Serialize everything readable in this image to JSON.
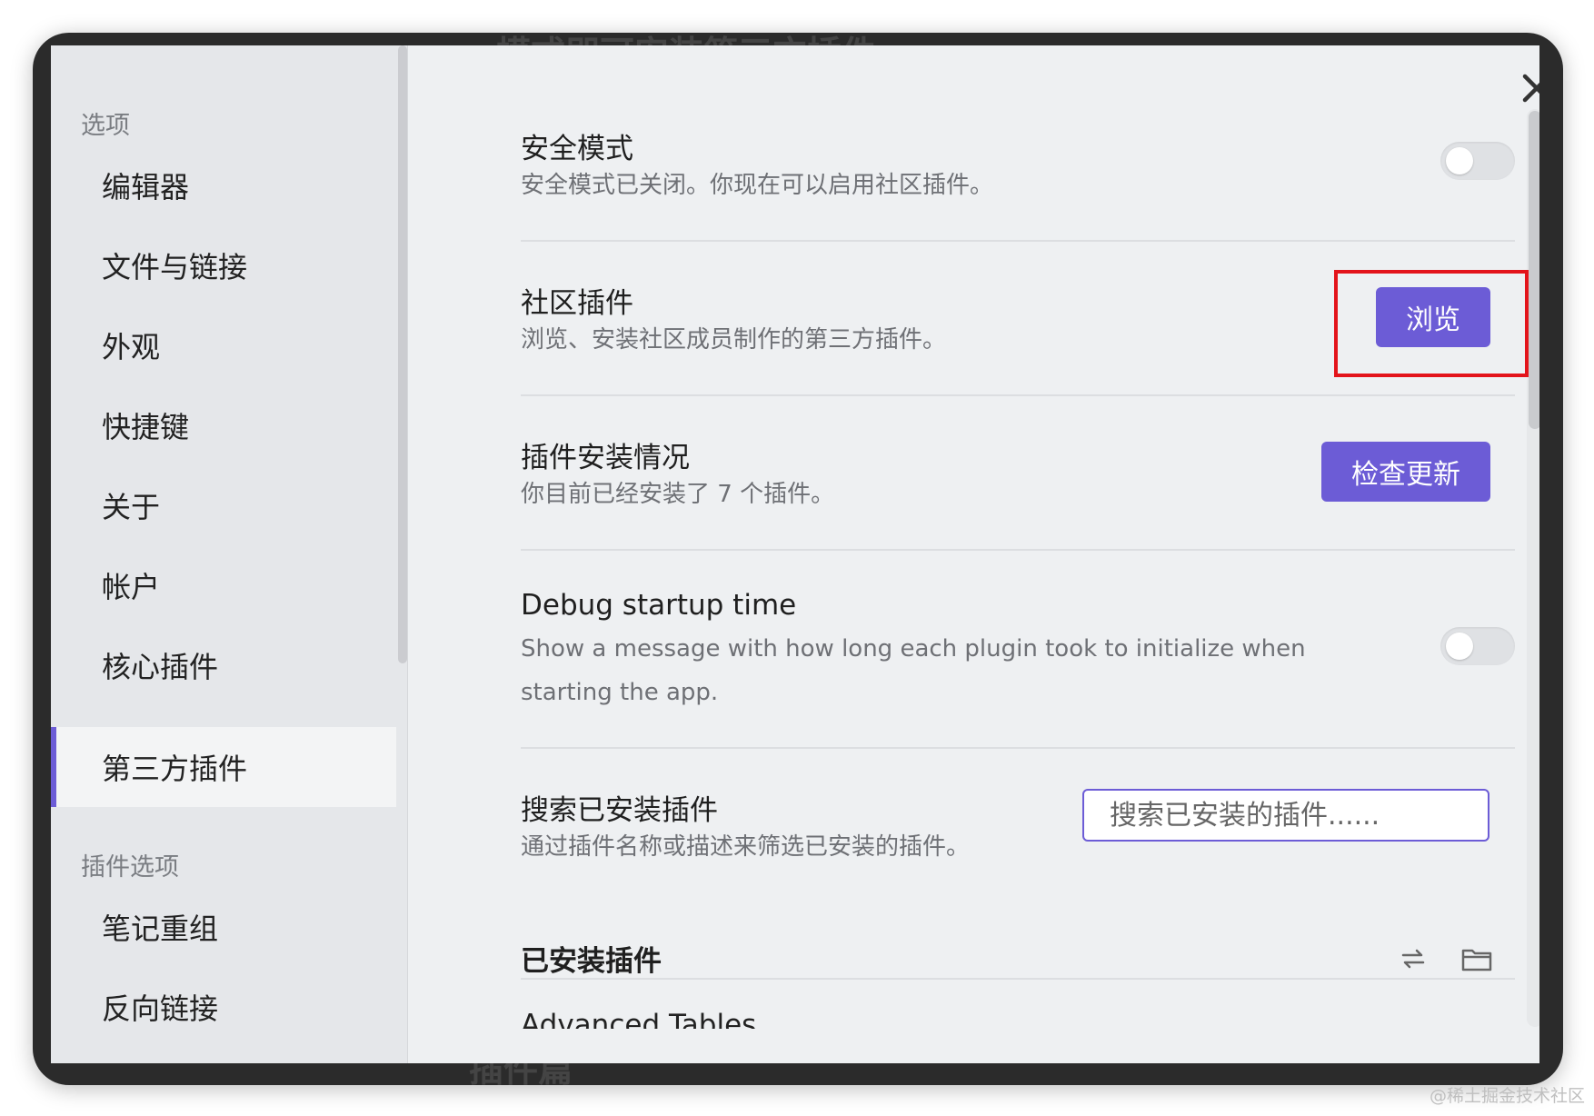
{
  "sidebar": {
    "options_heading": "选项",
    "items": [
      {
        "label": "编辑器"
      },
      {
        "label": "文件与链接"
      },
      {
        "label": "外观"
      },
      {
        "label": "快捷键"
      },
      {
        "label": "关于"
      },
      {
        "label": "帐户"
      },
      {
        "label": "核心插件"
      },
      {
        "label": "第三方插件",
        "active": true
      }
    ],
    "plugin_options_heading": "插件选项",
    "plugin_items": [
      {
        "label": "笔记重组"
      },
      {
        "label": "反向链接"
      }
    ]
  },
  "settings": {
    "safe_mode": {
      "title": "安全模式",
      "description": "安全模式已关闭。你现在可以启用社区插件。",
      "enabled": false
    },
    "community_plugins": {
      "title": "社区插件",
      "description": "浏览、安装社区成员制作的第三方插件。",
      "button_label": "浏览"
    },
    "install_status": {
      "title": "插件安装情况",
      "description": "你目前已经安装了 7 个插件。",
      "button_label": "检查更新"
    },
    "debug_startup": {
      "title": "Debug startup time",
      "description_line1": "Show a message with how long each plugin took to initialize when",
      "description_line2": "starting the app.",
      "enabled": false
    },
    "search_installed": {
      "title": "搜索已安装插件",
      "description": "通过插件名称或描述来筛选已安装的插件。",
      "placeholder": "搜索已安装的插件......"
    },
    "installed_plugins": {
      "heading": "已安装插件",
      "first_plugin": "Advanced Tables"
    }
  },
  "icons": {
    "close": "close-icon",
    "reload": "reload-icon",
    "folder": "folder-icon"
  },
  "colors": {
    "accent": "#6c5cd6",
    "highlight": "#e3141b"
  },
  "background_text": {
    "top": "模式即可安装第三方插件",
    "bottom": "插件篇"
  },
  "watermark": "@稀土掘金技术社区"
}
